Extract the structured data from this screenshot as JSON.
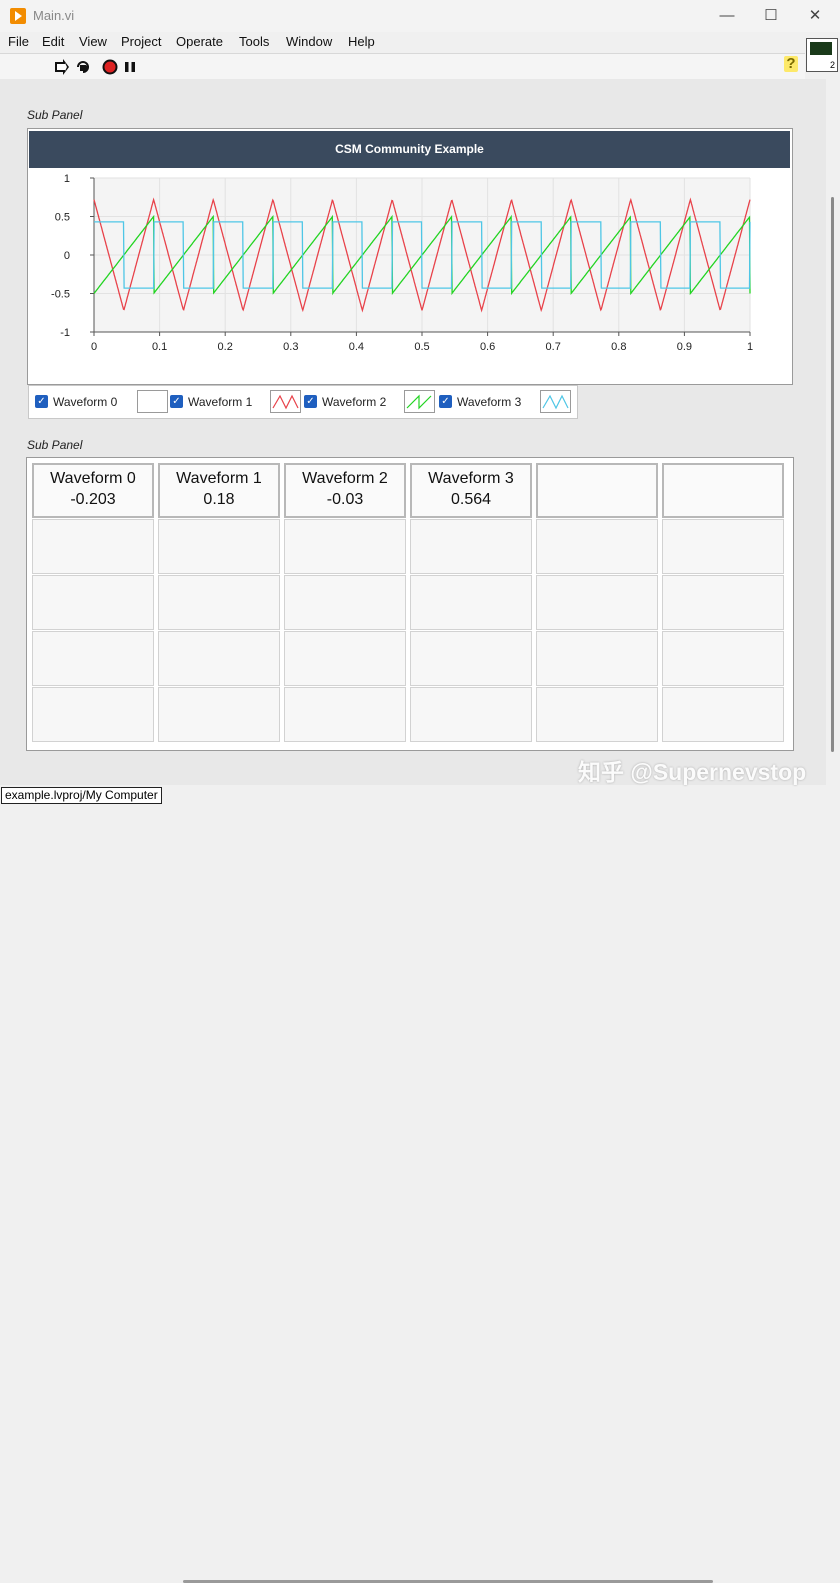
{
  "window": {
    "title": "Main.vi",
    "minimize": "—",
    "maximize": "☐",
    "close": "✕"
  },
  "menu": [
    "File",
    "Edit",
    "View",
    "Project",
    "Operate",
    "Tools",
    "Window",
    "Help"
  ],
  "toolbar": {
    "icons": [
      "run-arrow-icon",
      "run-continuous-icon",
      "abort-icon",
      "pause-icon"
    ],
    "help_icon": "?",
    "vi_icon_number": "2"
  },
  "sections": {
    "chart_label": "Sub Panel",
    "table_label": "Sub Panel"
  },
  "chart_header": "CSM Community Example",
  "legend": [
    {
      "name": "Waveform 0",
      "color": "#ffffff"
    },
    {
      "name": "Waveform 1",
      "color": "#e8424a"
    },
    {
      "name": "Waveform 2",
      "color": "#22d422"
    },
    {
      "name": "Waveform 3",
      "color": "#4ec6e6"
    }
  ],
  "chart_data": {
    "type": "line",
    "title": "",
    "xlim": [
      0,
      1
    ],
    "ylim": [
      -1,
      1
    ],
    "x_ticks": [
      "0",
      "0.1",
      "0.2",
      "0.3",
      "0.4",
      "0.5",
      "0.6",
      "0.7",
      "0.8",
      "0.9",
      "1"
    ],
    "y_ticks": [
      "1",
      "0.5",
      "0",
      "-0.5",
      "-1"
    ],
    "grid": true,
    "series": [
      {
        "name": "Waveform 1",
        "color": "#e8424a",
        "shape": "triangle",
        "frequency": 11,
        "amplitude": 0.72
      },
      {
        "name": "Waveform 2",
        "color": "#22d422",
        "shape": "sawtooth",
        "frequency": 11,
        "amplitude": 0.5
      },
      {
        "name": "Waveform 3",
        "color": "#4ec6e6",
        "shape": "square",
        "frequency": 11,
        "amplitude": 0.43
      }
    ]
  },
  "table": {
    "headers": [
      {
        "title": "Waveform 0",
        "value": "-0.203"
      },
      {
        "title": "Waveform 1",
        "value": "0.18"
      },
      {
        "title": "Waveform 2",
        "value": "-0.03"
      },
      {
        "title": "Waveform 3",
        "value": "0.564"
      },
      {
        "title": "",
        "value": ""
      },
      {
        "title": "",
        "value": ""
      }
    ],
    "empty_rows": 4
  },
  "status": {
    "path": "example.lvproj/My Computer"
  },
  "watermark": "知乎 @Supernevstop"
}
